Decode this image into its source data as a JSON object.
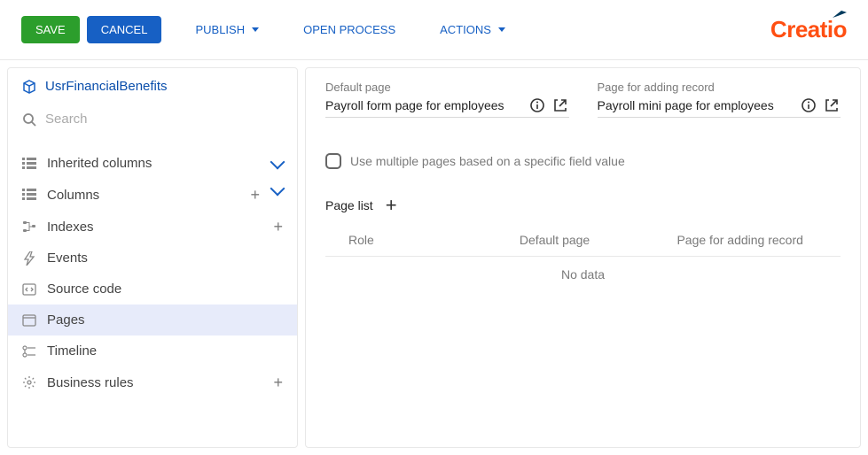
{
  "toolbar": {
    "save": "SAVE",
    "cancel": "CANCEL",
    "publish": "PUBLISH",
    "open_process": "OPEN PROCESS",
    "actions": "ACTIONS"
  },
  "brand": "Creatio",
  "object": {
    "name": "UsrFinancialBenefits"
  },
  "search": {
    "placeholder": "Search"
  },
  "sidebar": {
    "items": [
      {
        "label": "Inherited columns",
        "has_add": false,
        "has_expand": true
      },
      {
        "label": "Columns",
        "has_add": true,
        "has_expand": true
      },
      {
        "label": "Indexes",
        "has_add": true,
        "has_expand": false
      },
      {
        "label": "Events",
        "has_add": false,
        "has_expand": false
      },
      {
        "label": "Source code",
        "has_add": false,
        "has_expand": false
      },
      {
        "label": "Pages",
        "has_add": false,
        "has_expand": false
      },
      {
        "label": "Timeline",
        "has_add": false,
        "has_expand": false
      },
      {
        "label": "Business rules",
        "has_add": true,
        "has_expand": false
      }
    ]
  },
  "content": {
    "default_page_label": "Default page",
    "default_page_value": "Payroll form page for employees",
    "add_page_label": "Page for adding record",
    "add_page_value": "Payroll mini page for employees",
    "multi_checkbox_label": "Use multiple pages based on a specific field value",
    "page_list_title": "Page list",
    "page_list_cols": {
      "role": "Role",
      "default_page": "Default page",
      "add_page": "Page for adding record"
    },
    "empty_text": "No data"
  }
}
